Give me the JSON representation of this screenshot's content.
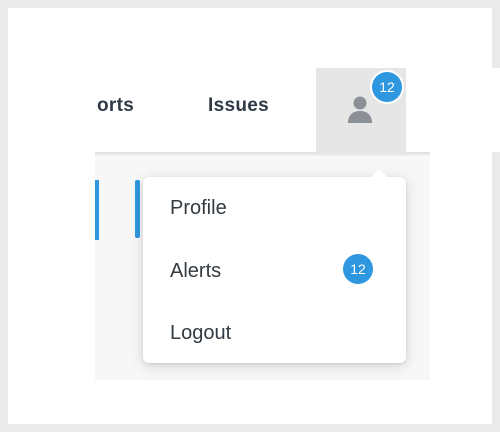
{
  "nav": {
    "items": [
      {
        "label": "orts"
      },
      {
        "label": "Issues"
      }
    ],
    "user": {
      "icon": "user-icon",
      "badge_count": "12"
    }
  },
  "dropdown": {
    "items": [
      {
        "label": "Profile"
      },
      {
        "label": "Alerts",
        "badge": "12"
      },
      {
        "label": "Logout"
      }
    ]
  },
  "colors": {
    "accent": "#2e97e0",
    "text": "#333a40",
    "user_tab_bg": "#e6e6e6"
  }
}
